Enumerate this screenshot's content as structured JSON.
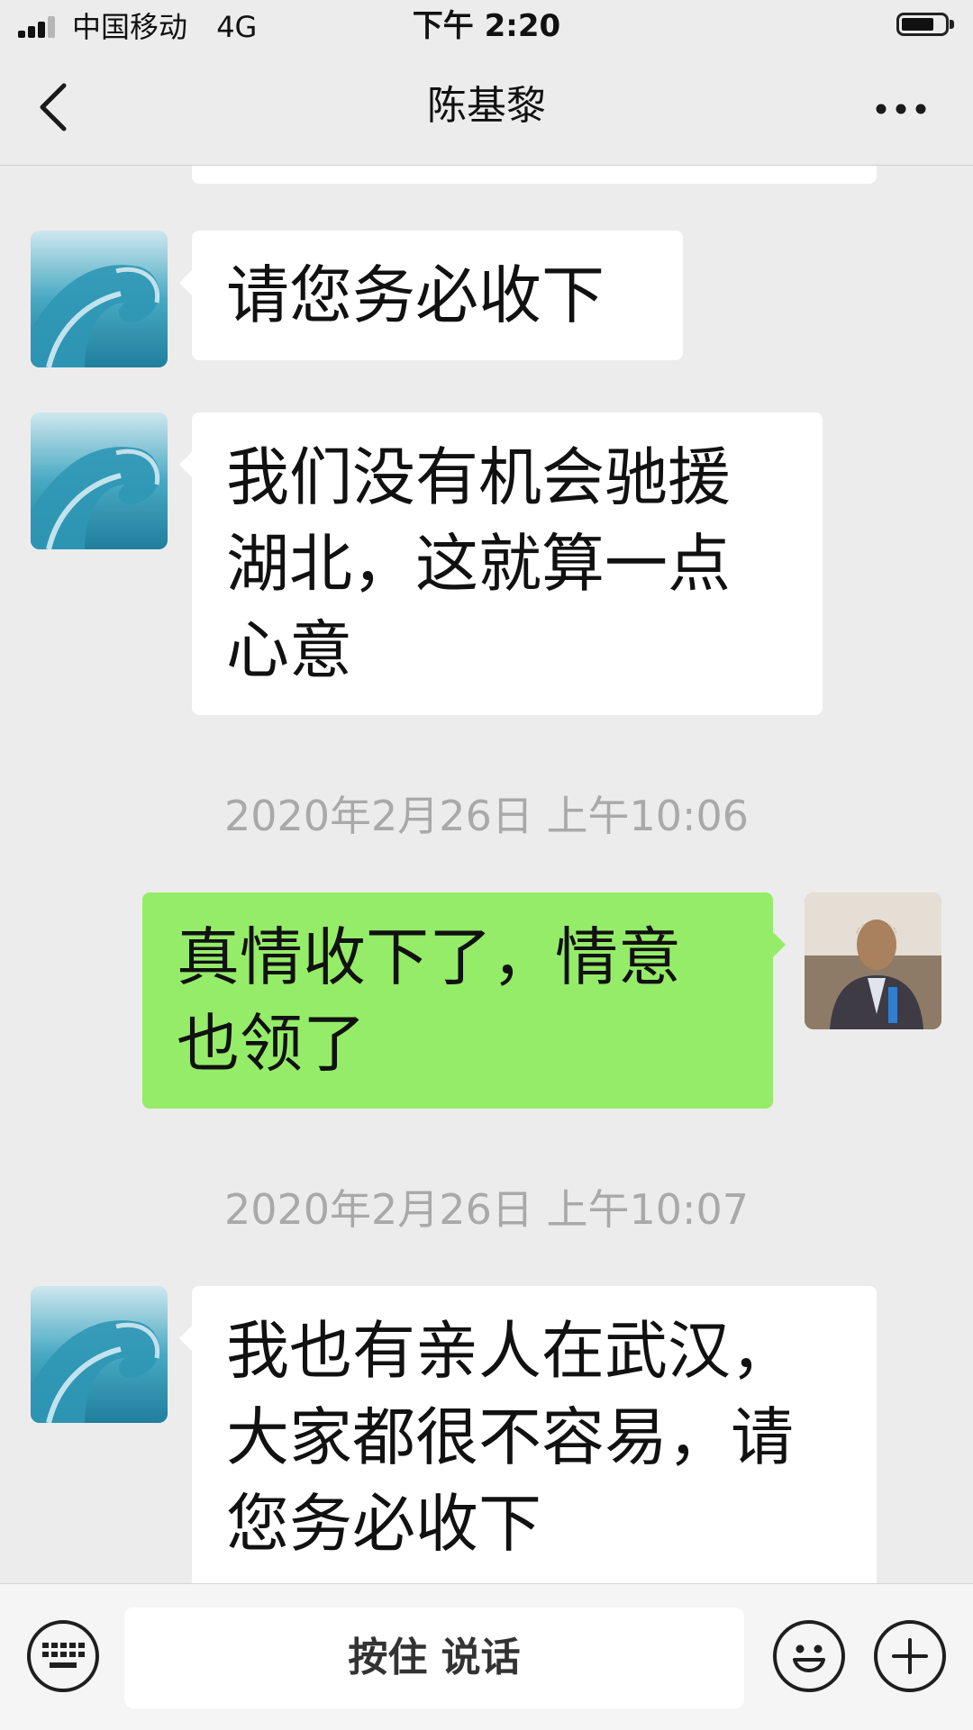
{
  "status_bar": {
    "carrier": "中国移动",
    "network": "4G",
    "time": "下午 2:20",
    "battery_level": 0.75
  },
  "nav": {
    "title": "陈基黎"
  },
  "messages": [
    {
      "side": "left",
      "text": "请您务必收下"
    },
    {
      "side": "left",
      "text": "我们没有机会驰援湖北，这就算一点心意"
    },
    {
      "side": "right",
      "text": "真情收下了，情意也领了"
    },
    {
      "side": "left",
      "text": "我也有亲人在武汉，大家都很不容易，请您务必收下"
    }
  ],
  "timestamps": [
    "2020年2月26日 上午10:06",
    "2020年2月26日 上午10:07"
  ],
  "input_bar": {
    "voice_label": "按住 说话"
  },
  "colors": {
    "background": "#ececec",
    "bubble_other": "#ffffff",
    "bubble_self": "#95ec69",
    "timestamp": "#a9a9a9"
  },
  "icons": {
    "back": "chevron-left-icon",
    "more": "more-dots-icon",
    "keyboard": "keyboard-icon",
    "emoji": "emoji-icon",
    "plus": "plus-icon"
  }
}
